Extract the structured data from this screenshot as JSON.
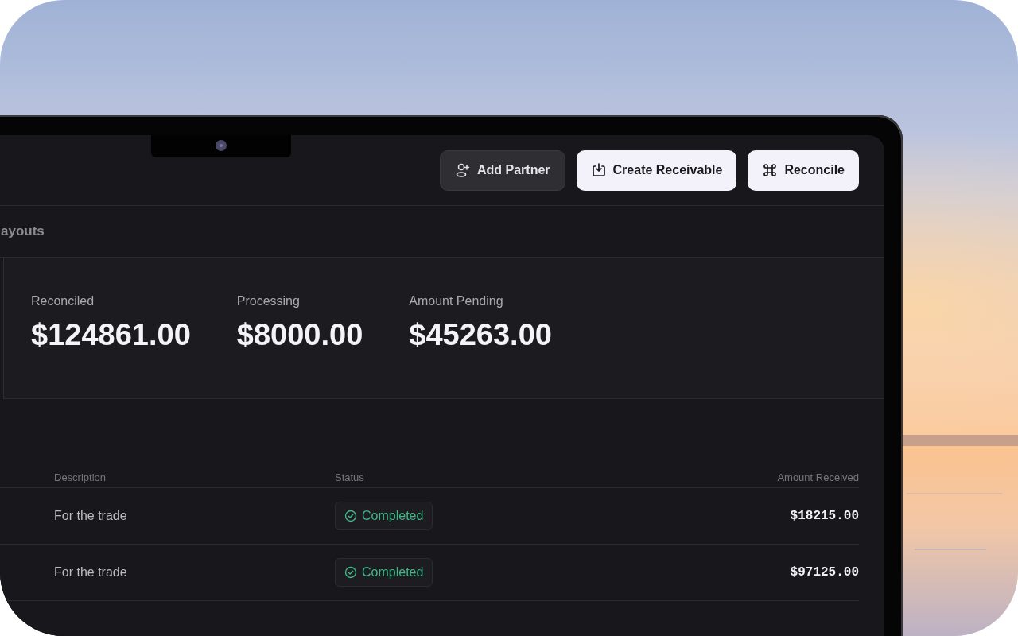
{
  "toolbar": {
    "buttons": [
      {
        "label": "Add Partner",
        "kind": "secondary"
      },
      {
        "label": "Create Receivable",
        "kind": "primary"
      },
      {
        "label": "Reconcile",
        "kind": "primary"
      }
    ]
  },
  "section": {
    "title": "ayouts"
  },
  "stats": [
    {
      "label": "Reconciled",
      "value": "$124861.00"
    },
    {
      "label": "Processing",
      "value": "$8000.00"
    },
    {
      "label": "Amount Pending",
      "value": "$45263.00"
    }
  ],
  "table": {
    "columns": [
      "Description",
      "Status",
      "Amount Received"
    ],
    "rows": [
      {
        "description": "For the trade",
        "status": "Completed",
        "amount": "$18215.00"
      },
      {
        "description": "For the trade",
        "status": "Completed",
        "amount": "$97125.00"
      }
    ]
  }
}
